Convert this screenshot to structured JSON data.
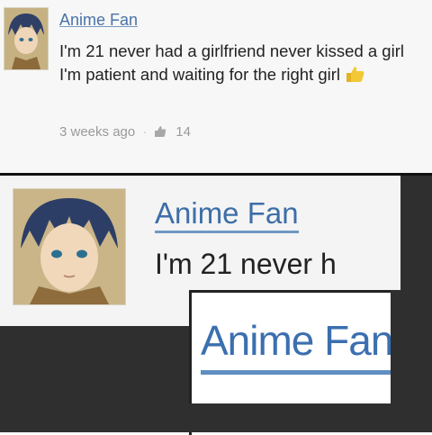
{
  "post": {
    "username": "Anime Fan",
    "comment_text": "I'm 21 never had a girlfriend never kissed a girl I'm patient and waiting for the right girl",
    "timestamp": "3 weeks ago",
    "like_count": "14",
    "icons": {
      "avatar": "avatar-anime",
      "inline_emoji": "thumbs-up-emoji",
      "like": "like-icon"
    }
  },
  "zoom": {
    "username": "Anime Fan",
    "comment_fragment": "I'm 21 never h"
  },
  "super_zoom": {
    "username": "Anime Fan"
  },
  "colors": {
    "link": "#4a73a8",
    "text": "#222222",
    "meta": "#9a9a9a",
    "dark_bg": "#2f2f2f"
  }
}
